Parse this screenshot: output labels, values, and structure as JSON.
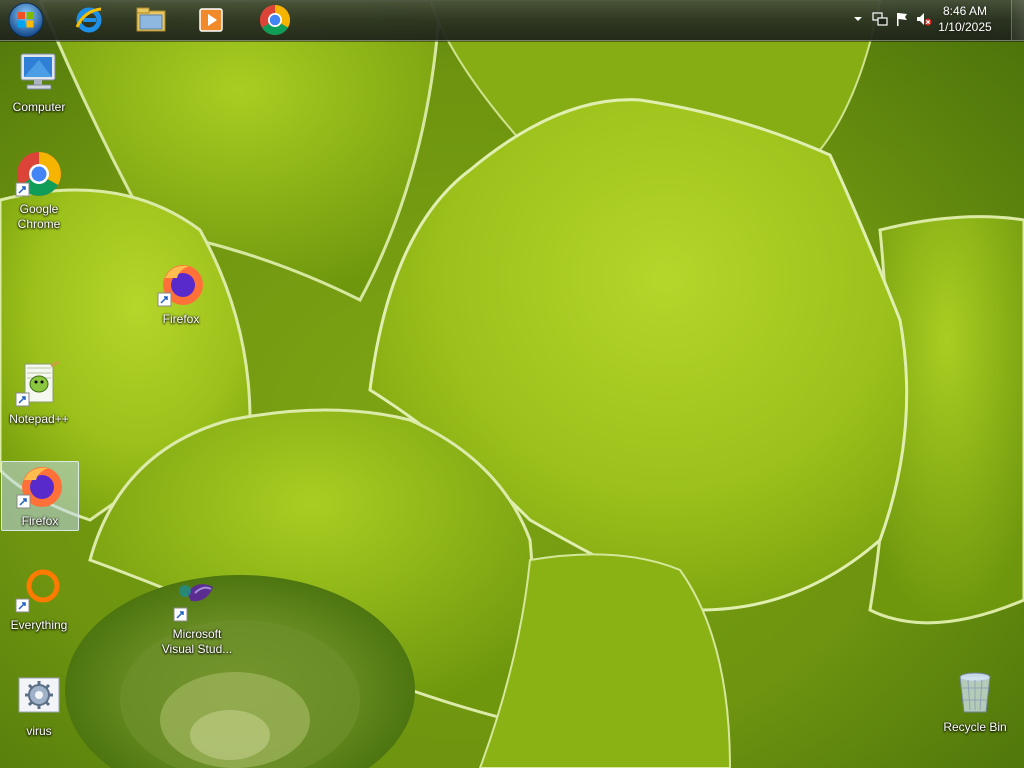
{
  "taskbar": {
    "start_icon": "windows-orb-icon",
    "pinned_apps": [
      {
        "name": "internet-explorer-icon"
      },
      {
        "name": "file-explorer-icon"
      },
      {
        "name": "media-player-icon"
      },
      {
        "name": "google-chrome-icon"
      }
    ],
    "tray": {
      "time": "8:46 AM",
      "date": "1/10/2025",
      "icons": [
        "show-hidden-icons",
        "network-icon",
        "action-center-flag-icon",
        "volume-muted-icon"
      ]
    }
  },
  "desktop": {
    "icons": [
      {
        "label": "Computer",
        "icon": "computer-icon"
      },
      {
        "label": "Google Chrome",
        "icon": "google-chrome-icon"
      },
      {
        "label": "Firefox",
        "icon": "firefox-icon"
      },
      {
        "label": "Notepad++",
        "icon": "notepad-plus-plus-icon"
      },
      {
        "label": "Firefox",
        "icon": "firefox-icon",
        "selected": true
      },
      {
        "label": "Everything",
        "icon": "everything-search-icon"
      },
      {
        "label": "Microsoft Visual Stud...",
        "icon": "visual-studio-icon"
      },
      {
        "label": "virus",
        "icon": "settings-file-icon"
      },
      {
        "label": "Recycle Bin",
        "icon": "recycle-bin-icon"
      }
    ]
  },
  "colors": {
    "leaf_light": "#b8d82a",
    "leaf_mid": "#8fb514",
    "leaf_dark": "#4f7a08",
    "selection": "#bed7eb"
  }
}
